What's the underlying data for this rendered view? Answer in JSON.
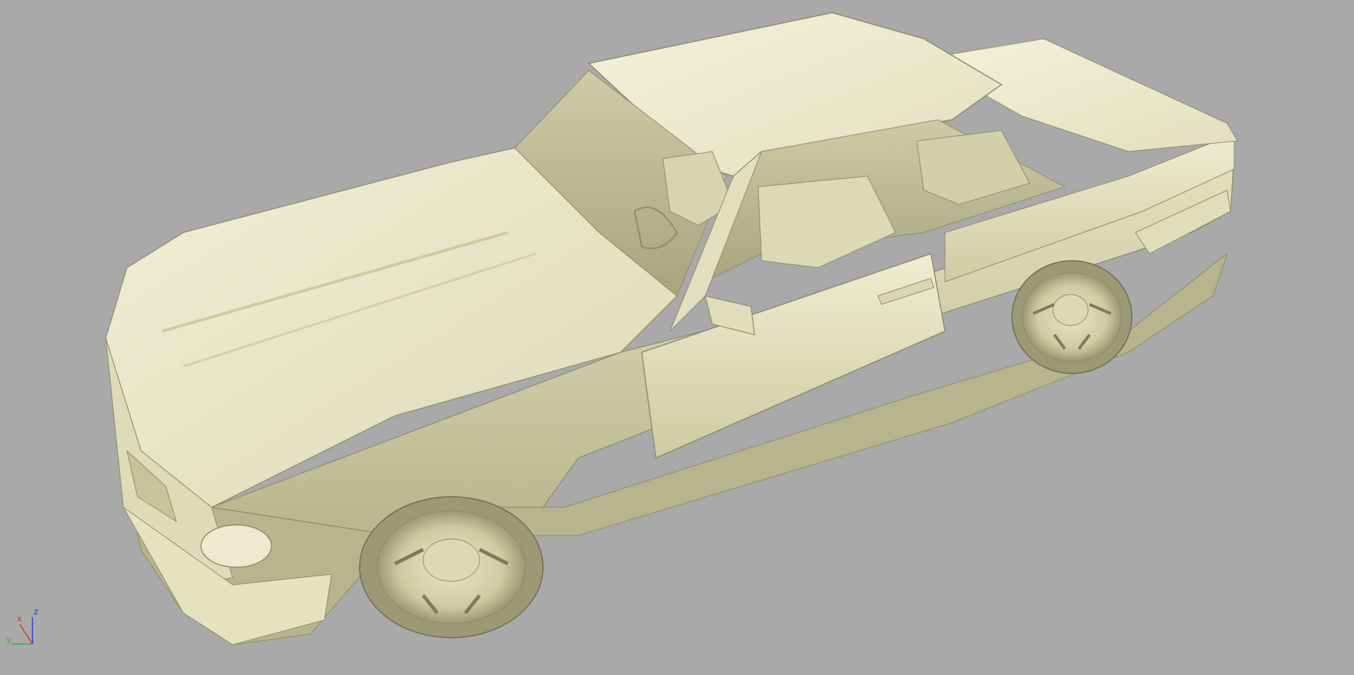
{
  "viewport": {
    "background_color": "#a9a9a9",
    "model_color": "#e6e3c2",
    "render_mode": "shaded"
  },
  "axis_gizmo": {
    "x_label": "x",
    "y_label": "y",
    "z_label": "z",
    "x_color": "#d23a2a",
    "y_color": "#3fae3f",
    "z_color": "#2a3fd2"
  }
}
